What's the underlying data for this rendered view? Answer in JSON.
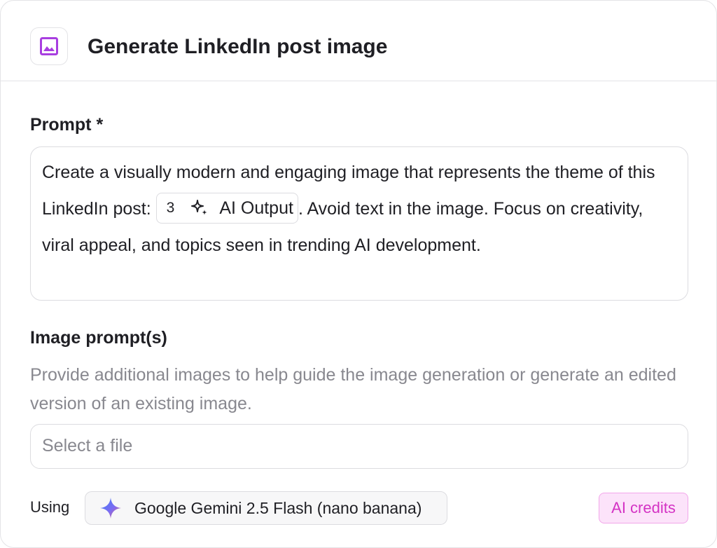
{
  "header": {
    "title": "Generate LinkedIn post image",
    "icon": "image-icon",
    "icon_color": "#a83ee0"
  },
  "prompt": {
    "label": "Prompt *",
    "text_before": "Create a visually modern and engaging image that represents the theme of this LinkedIn post: ",
    "variable": {
      "step_number": "3",
      "icon": "sparkle-icon",
      "label": "AI Output"
    },
    "text_after": ". Avoid text in the image. Focus on creativity, viral appeal, and topics seen in trending AI development."
  },
  "image_prompts": {
    "label": "Image prompt(s)",
    "helper": "Provide additional images to help guide the image generation or generate an edited version of an existing image.",
    "placeholder": "Select a file"
  },
  "footer": {
    "using_label": "Using",
    "model": {
      "icon": "gemini-icon",
      "label": "Google Gemini 2.5 Flash (nano banana)"
    },
    "credits_label": "AI credits",
    "credits_color": "#d433c4"
  }
}
